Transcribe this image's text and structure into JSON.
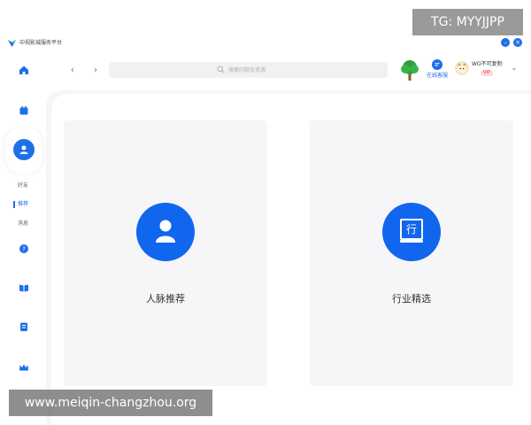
{
  "window": {
    "title": "中视影城服务平台",
    "minimize_glyph": "–",
    "close_glyph": "×"
  },
  "watermarks": {
    "top": "TG: MYYJJPP",
    "bottom": "www.meiqin-changzhou.org"
  },
  "toolbar": {
    "back_glyph": "‹",
    "forward_glyph": "›",
    "search_placeholder": "搜索问题及资源",
    "service_label": "在线客服",
    "user_name": "WO不可复制",
    "vip_badge": "VIP",
    "chevron_glyph": "⌄"
  },
  "sidebar": {
    "items": [
      {
        "icon": "home-icon"
      },
      {
        "icon": "calendar-icon"
      },
      {
        "icon": "person-icon",
        "active": true
      },
      {
        "icon": "help-icon"
      },
      {
        "icon": "book-icon"
      },
      {
        "icon": "document-icon"
      },
      {
        "icon": "crown-icon"
      }
    ],
    "sub_items": [
      {
        "label": "好友"
      },
      {
        "label": "推荐"
      },
      {
        "label": "消息"
      }
    ]
  },
  "cards": [
    {
      "label": "人脉推荐",
      "icon": "person-icon"
    },
    {
      "label": "行业精选",
      "icon": "industry-icon",
      "icon_char": "行"
    }
  ],
  "colors": {
    "accent": "#1e6fe8",
    "card_bg": "#f6f6f8",
    "badge_bg": "#ffd6d6"
  }
}
